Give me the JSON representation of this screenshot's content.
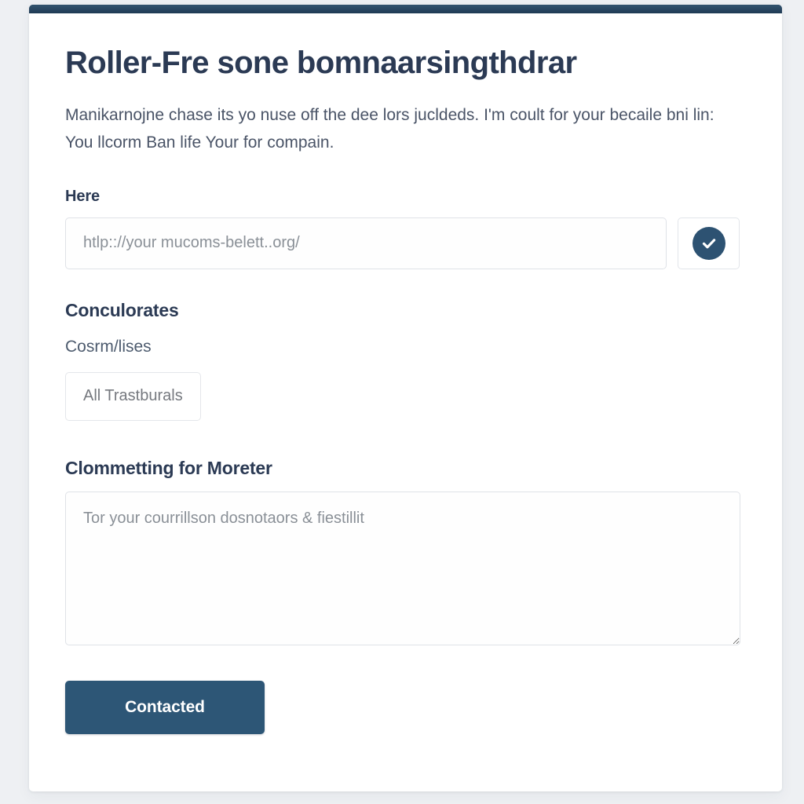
{
  "page": {
    "background_color": "#eef0f3",
    "card_background": "#ffffff",
    "accent_bar_color": "#2a4964",
    "heading_color": "#2b3a54",
    "primary_button_color": "#2d5676",
    "badge_color": "#2d5272"
  },
  "header": {
    "title": "Roller-Fre sone bomnaarsingthdrar",
    "paragraph": "Manikarnojne chase its yo nuse off the dee lors jucldeds. I'm coult for your becaile bni lin: You llcorm Ban life Your for compain."
  },
  "url_field": {
    "label": "Here",
    "placeholder": "htlp:://your mucoms-belett..org/",
    "value": "",
    "verify_icon": "check-circle-icon"
  },
  "collaborators": {
    "heading": "Conculorates",
    "subtext": "Cosrm/lises",
    "chip_label": "All Trastburals"
  },
  "comment": {
    "heading": "Clommetting for Moreter",
    "placeholder": "Tor your courrillson dosnotaors & fiestillit",
    "value": ""
  },
  "submit": {
    "label": "Contacted"
  }
}
